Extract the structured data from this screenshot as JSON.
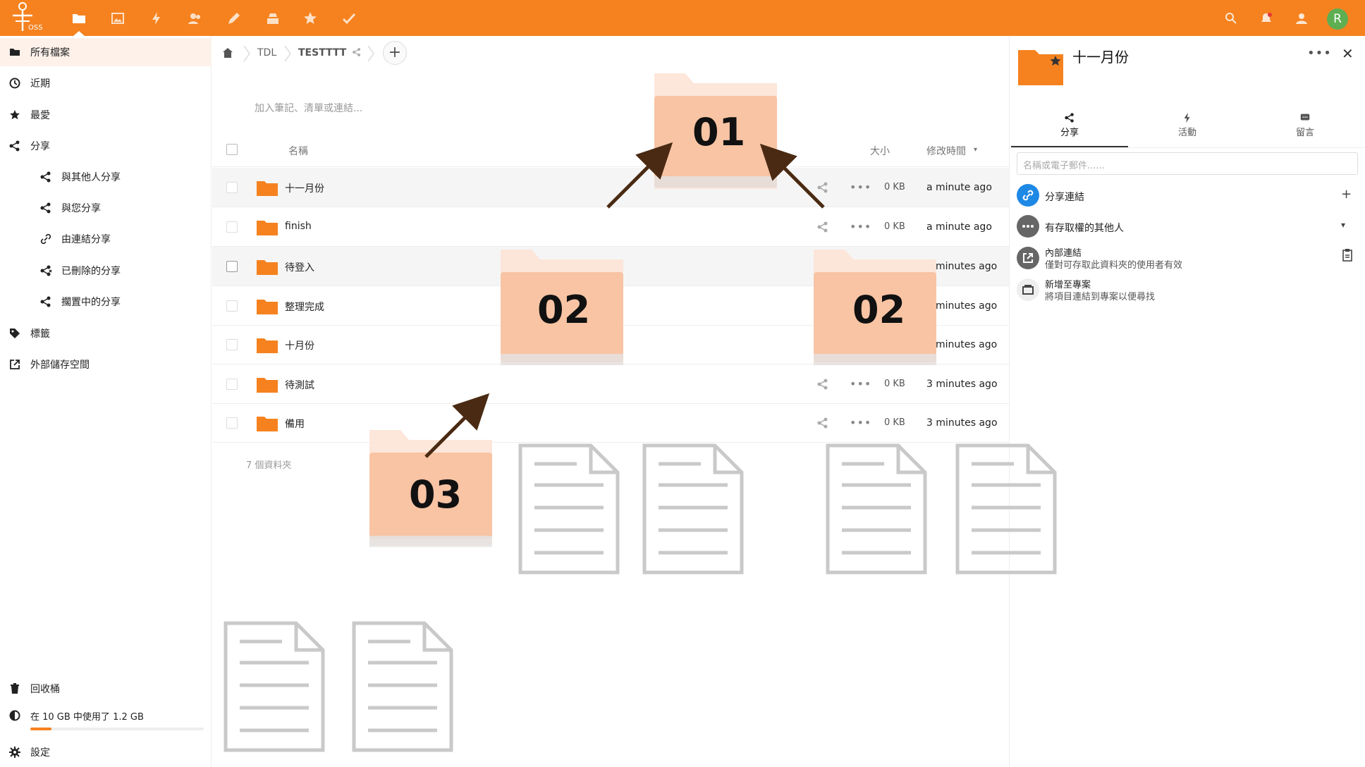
{
  "topbar": {
    "logo_text": "OSS",
    "avatar_initial": "R",
    "nav_icons": [
      "folder-icon",
      "image-icon",
      "lightning-icon",
      "contacts-icon",
      "pencil-icon",
      "deck-icon",
      "star-icon",
      "checkmark-icon"
    ],
    "right_icons": [
      "search-icon",
      "notification-icon",
      "contacts-menu-icon"
    ],
    "accent": "#f5821f"
  },
  "sidebar": {
    "all_files": "所有檔案",
    "recent": "近期",
    "favorites": "最愛",
    "shares": "分享",
    "shared_with_others": "與其他人分享",
    "shared_with_you": "與您分享",
    "shared_by_link": "由連結分享",
    "deleted_shares": "已刪除的分享",
    "pending_shares": "擱置中的分享",
    "tags": "標籤",
    "external_storage": "外部儲存空間",
    "trash": "回收桶",
    "quota": "在 10 GB 中使用了 1.2 GB",
    "quota_fraction": 0.12,
    "settings": "設定"
  },
  "breadcrumb": {
    "items": [
      "TDL",
      "TESTTTT"
    ]
  },
  "main": {
    "note_placeholder": "加入筆記、清單或連結...",
    "col_name": "名稱",
    "col_size": "大小",
    "col_modified": "修改時間",
    "rows": [
      {
        "name": "十一月份",
        "size": "0 KB",
        "modified": "a minute ago"
      },
      {
        "name": "finish",
        "size": "0 KB",
        "modified": "a minute ago"
      },
      {
        "name": "待登入",
        "size": "",
        "modified": "minutes ago"
      },
      {
        "name": "整理完成",
        "size": "",
        "modified": "minutes ago"
      },
      {
        "name": "十月份",
        "size": "",
        "modified": "minutes ago"
      },
      {
        "name": "待測試",
        "size": "0 KB",
        "modified": "3 minutes ago"
      },
      {
        "name": "備用",
        "size": "0 KB",
        "modified": "3 minutes ago"
      }
    ],
    "summary": "7 個資料夾"
  },
  "overlay": {
    "label_01": "01",
    "label_02a": "02",
    "label_02b": "02",
    "label_03": "03"
  },
  "details": {
    "title": "十一月份",
    "tabs": [
      "分享",
      "活動",
      "留言"
    ],
    "search_placeholder": "名稱或電子郵件......",
    "share_link": "分享連結",
    "others_with_access": "有存取權的其他人",
    "internal_link": "內部連結",
    "internal_link_desc": "僅對可存取此資料夾的使用者有效",
    "add_to_project": "新增至專案",
    "add_to_project_desc": "將項目連結到專案以便尋找"
  }
}
